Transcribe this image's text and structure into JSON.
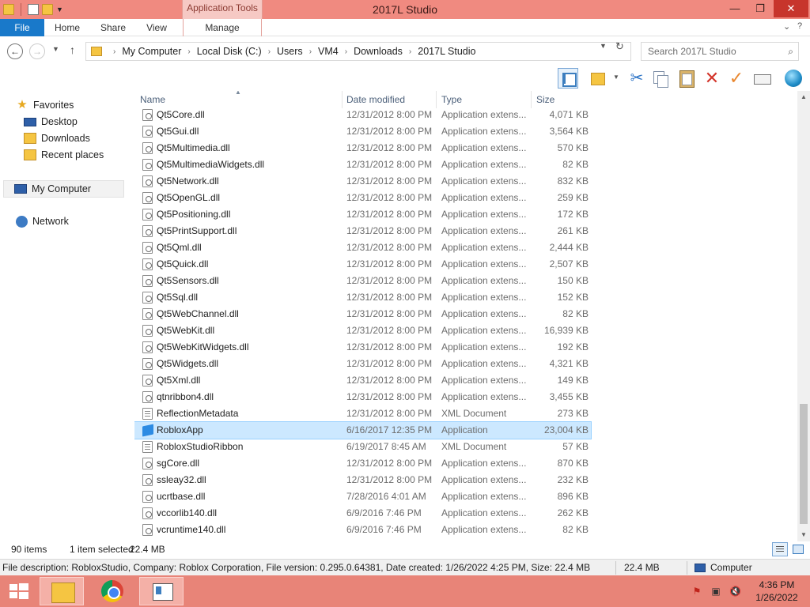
{
  "window": {
    "title": "2017L Studio",
    "context_tab_group": "Application Tools",
    "min_glyph": "—",
    "max_glyph": "❐",
    "close_glyph": "✕"
  },
  "ribbon": {
    "tabs": [
      "File",
      "Home",
      "Share",
      "View",
      "Manage"
    ],
    "collapse_glyph": "⌄",
    "help_glyph": "?"
  },
  "address": {
    "crumbs": [
      "My Computer",
      "Local Disk (C:)",
      "Users",
      "VM4",
      "Downloads",
      "2017L Studio"
    ],
    "search_placeholder": "Search 2017L Studio"
  },
  "nav": {
    "favorites": "Favorites",
    "desktop": "Desktop",
    "downloads": "Downloads",
    "recent": "Recent places",
    "computer": "My Computer",
    "network": "Network"
  },
  "columns": {
    "name": "Name",
    "date": "Date modified",
    "type": "Type",
    "size": "Size"
  },
  "files": [
    {
      "name": "Qt5Core.dll",
      "date": "12/31/2012 8:00 PM",
      "type": "Application extens...",
      "size": "4,071 KB",
      "icon": "dll-file-icon"
    },
    {
      "name": "Qt5Gui.dll",
      "date": "12/31/2012 8:00 PM",
      "type": "Application extens...",
      "size": "3,564 KB",
      "icon": "dll-file-icon"
    },
    {
      "name": "Qt5Multimedia.dll",
      "date": "12/31/2012 8:00 PM",
      "type": "Application extens...",
      "size": "570 KB",
      "icon": "dll-file-icon"
    },
    {
      "name": "Qt5MultimediaWidgets.dll",
      "date": "12/31/2012 8:00 PM",
      "type": "Application extens...",
      "size": "82 KB",
      "icon": "dll-file-icon"
    },
    {
      "name": "Qt5Network.dll",
      "date": "12/31/2012 8:00 PM",
      "type": "Application extens...",
      "size": "832 KB",
      "icon": "dll-file-icon"
    },
    {
      "name": "Qt5OpenGL.dll",
      "date": "12/31/2012 8:00 PM",
      "type": "Application extens...",
      "size": "259 KB",
      "icon": "dll-file-icon"
    },
    {
      "name": "Qt5Positioning.dll",
      "date": "12/31/2012 8:00 PM",
      "type": "Application extens...",
      "size": "172 KB",
      "icon": "dll-file-icon"
    },
    {
      "name": "Qt5PrintSupport.dll",
      "date": "12/31/2012 8:00 PM",
      "type": "Application extens...",
      "size": "261 KB",
      "icon": "dll-file-icon"
    },
    {
      "name": "Qt5Qml.dll",
      "date": "12/31/2012 8:00 PM",
      "type": "Application extens...",
      "size": "2,444 KB",
      "icon": "dll-file-icon"
    },
    {
      "name": "Qt5Quick.dll",
      "date": "12/31/2012 8:00 PM",
      "type": "Application extens...",
      "size": "2,507 KB",
      "icon": "dll-file-icon"
    },
    {
      "name": "Qt5Sensors.dll",
      "date": "12/31/2012 8:00 PM",
      "type": "Application extens...",
      "size": "150 KB",
      "icon": "dll-file-icon"
    },
    {
      "name": "Qt5Sql.dll",
      "date": "12/31/2012 8:00 PM",
      "type": "Application extens...",
      "size": "152 KB",
      "icon": "dll-file-icon"
    },
    {
      "name": "Qt5WebChannel.dll",
      "date": "12/31/2012 8:00 PM",
      "type": "Application extens...",
      "size": "82 KB",
      "icon": "dll-file-icon"
    },
    {
      "name": "Qt5WebKit.dll",
      "date": "12/31/2012 8:00 PM",
      "type": "Application extens...",
      "size": "16,939 KB",
      "icon": "dll-file-icon"
    },
    {
      "name": "Qt5WebKitWidgets.dll",
      "date": "12/31/2012 8:00 PM",
      "type": "Application extens...",
      "size": "192 KB",
      "icon": "dll-file-icon"
    },
    {
      "name": "Qt5Widgets.dll",
      "date": "12/31/2012 8:00 PM",
      "type": "Application extens...",
      "size": "4,321 KB",
      "icon": "dll-file-icon"
    },
    {
      "name": "Qt5Xml.dll",
      "date": "12/31/2012 8:00 PM",
      "type": "Application extens...",
      "size": "149 KB",
      "icon": "dll-file-icon"
    },
    {
      "name": "qtnribbon4.dll",
      "date": "12/31/2012 8:00 PM",
      "type": "Application extens...",
      "size": "3,455 KB",
      "icon": "dll-file-icon"
    },
    {
      "name": "ReflectionMetadata",
      "date": "12/31/2012 8:00 PM",
      "type": "XML Document",
      "size": "273 KB",
      "icon": "xml-file-icon"
    },
    {
      "name": "RobloxApp",
      "date": "6/16/2017 12:35 PM",
      "type": "Application",
      "size": "23,004 KB",
      "icon": "roblox-app-icon",
      "selected": true
    },
    {
      "name": "RobloxStudioRibbon",
      "date": "6/19/2017 8:45 AM",
      "type": "XML Document",
      "size": "57 KB",
      "icon": "xml-file-icon"
    },
    {
      "name": "sgCore.dll",
      "date": "12/31/2012 8:00 PM",
      "type": "Application extens...",
      "size": "870 KB",
      "icon": "dll-file-icon"
    },
    {
      "name": "ssleay32.dll",
      "date": "12/31/2012 8:00 PM",
      "type": "Application extens...",
      "size": "232 KB",
      "icon": "dll-file-icon"
    },
    {
      "name": "ucrtbase.dll",
      "date": "7/28/2016 4:01 AM",
      "type": "Application extens...",
      "size": "896 KB",
      "icon": "dll-file-icon"
    },
    {
      "name": "vccorlib140.dll",
      "date": "6/9/2016 7:46 PM",
      "type": "Application extens...",
      "size": "262 KB",
      "icon": "dll-file-icon"
    },
    {
      "name": "vcruntime140.dll",
      "date": "6/9/2016 7:46 PM",
      "type": "Application extens...",
      "size": "82 KB",
      "icon": "dll-file-icon"
    }
  ],
  "status": {
    "item_count": "90 items",
    "selected": "1 item selected",
    "selected_size": "22.4 MB"
  },
  "info": {
    "description": "File description: RobloxStudio, Company: Roblox Corporation, File version: 0.295.0.64381, Date created: 1/26/2022 4:25 PM, Size: 22.4 MB",
    "size": "22.4 MB",
    "location": "Computer"
  },
  "taskbar": {
    "time": "4:36 PM",
    "date": "1/26/2022"
  },
  "colors": {
    "titlebar": "#f08a80",
    "file_tab": "#1979ca",
    "taskbar": "#e88478",
    "selection": "#cce8ff"
  }
}
